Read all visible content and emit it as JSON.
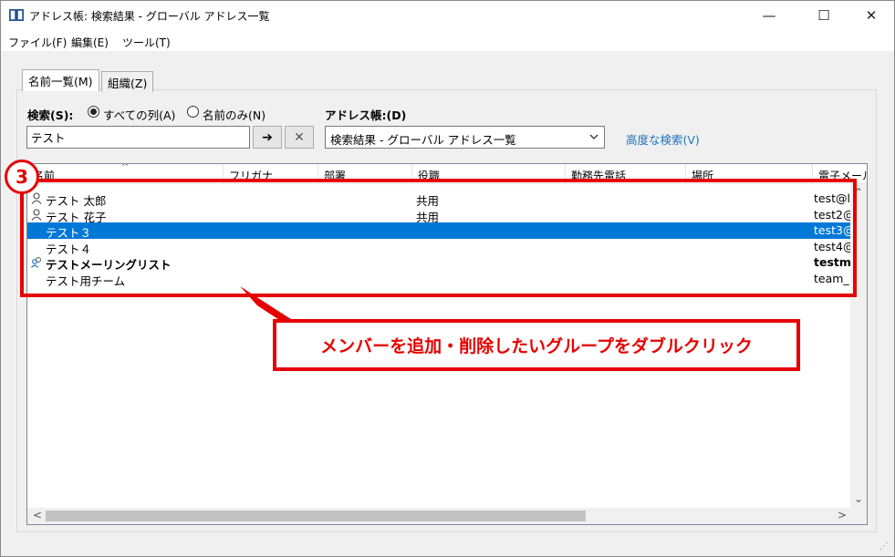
{
  "window": {
    "title": "アドレス帳: 検索結果 - グローバル アドレス一覧",
    "minimize_glyph": "—",
    "maximize_glyph": "☐",
    "close_glyph": "✕"
  },
  "menu": [
    "ファイル(F)",
    "編集(E)",
    "ツール(T)"
  ],
  "tabs": {
    "names": "名前一覧(M)",
    "org": "組織(Z)"
  },
  "search": {
    "label": "検索(S):",
    "option_all": "すべての列(A)",
    "option_name": "名前のみ(N)",
    "selected_option": "すべての列(A)",
    "value": "テスト",
    "go_glyph": "➔",
    "clear_glyph": "✕"
  },
  "address_book": {
    "label": "アドレス帳:(D)",
    "selected": "検索結果 - グローバル アドレス一覧"
  },
  "advanced_search": "高度な検索(V)",
  "columns": [
    "名前",
    "フリガナ",
    "部署",
    "役職",
    "勤務先電話",
    "場所",
    "電子メール"
  ],
  "rows": [
    {
      "icon": "person-icon",
      "name": "テスト 太郎",
      "title": "共用",
      "email": "test@l",
      "bold": false,
      "selected": false
    },
    {
      "icon": "person-icon",
      "name": "テスト 花子",
      "title": "共用",
      "email": "test2@",
      "bold": false,
      "selected": false
    },
    {
      "icon": "",
      "name": "テスト３",
      "title": "",
      "email": "test3@",
      "bold": false,
      "selected": true
    },
    {
      "icon": "",
      "name": "テスト４",
      "title": "",
      "email": "test4@",
      "bold": false,
      "selected": false
    },
    {
      "icon": "group-icon",
      "name": "テストメーリングリスト",
      "title": "",
      "email": "testm",
      "bold": true,
      "selected": false
    },
    {
      "icon": "",
      "name": "テスト用チーム",
      "title": "",
      "email": "team_",
      "bold": false,
      "selected": false
    }
  ],
  "annotation": {
    "step": "3",
    "text": "メンバーを追加・削除したいグループをダブルクリック",
    "color": "#e60000"
  },
  "colors": {
    "selection": "#0078d7",
    "link": "#1e73be"
  }
}
